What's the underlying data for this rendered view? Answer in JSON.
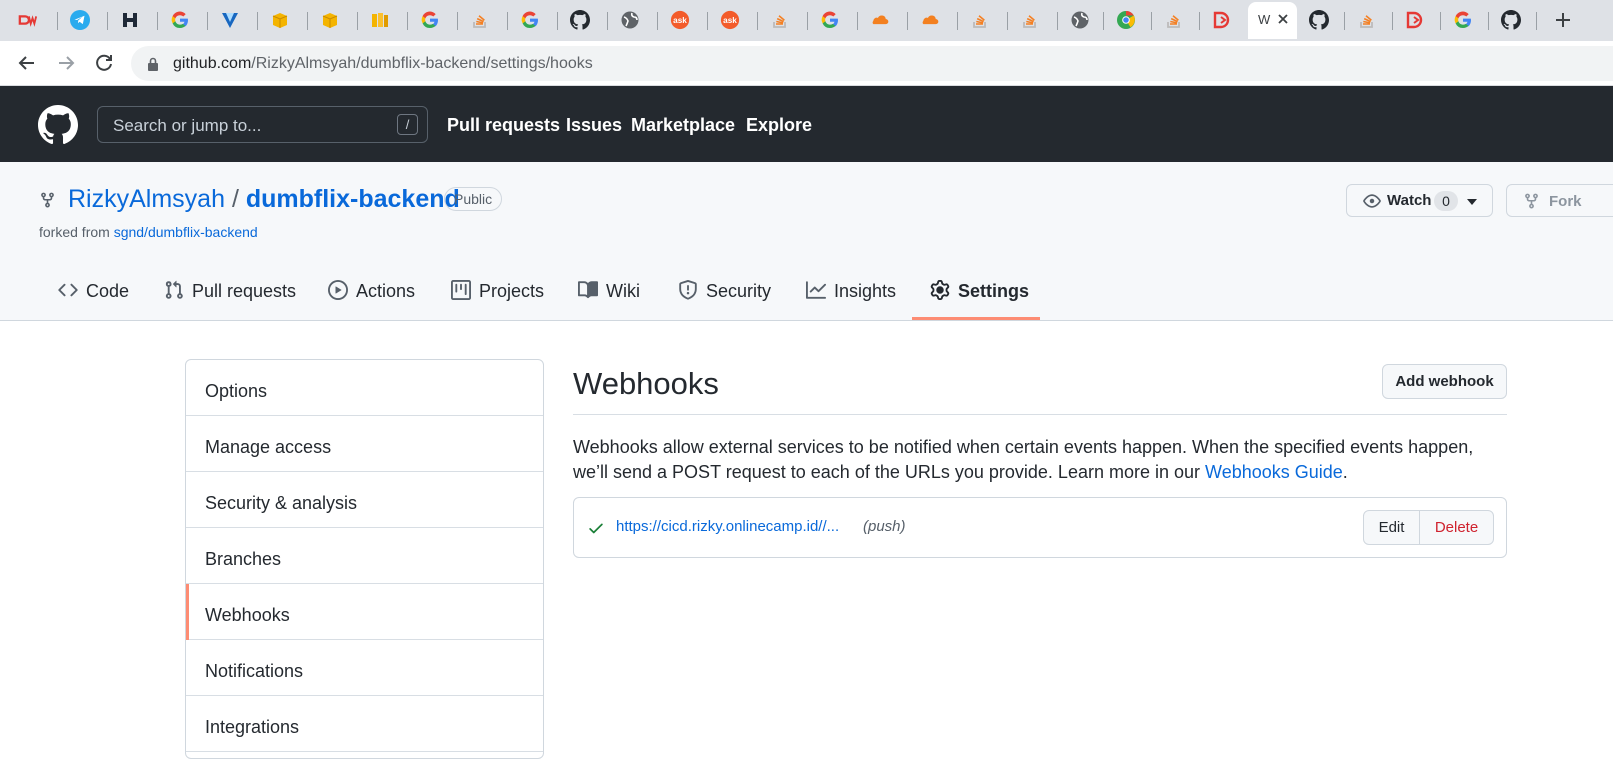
{
  "browser": {
    "tabs": [
      {
        "icon": "dumbways-icon",
        "color": "#e53935"
      },
      {
        "icon": "telegram-icon",
        "color": "#2aabee"
      },
      {
        "icon": "hackerrank-icon",
        "color": "#1f2937"
      },
      {
        "icon": "google-icon",
        "color": "#4285f4"
      },
      {
        "icon": "vuetify-icon",
        "color": "#1867c0"
      },
      {
        "icon": "box-icon",
        "color": "#f4b400"
      },
      {
        "icon": "box-icon",
        "color": "#f4b400"
      },
      {
        "icon": "books-icon",
        "color": "#f4b400"
      },
      {
        "icon": "google-icon",
        "color": "#4285f4"
      },
      {
        "icon": "stackoverflow-icon",
        "color": "#f48024"
      },
      {
        "icon": "google-icon",
        "color": "#4285f4"
      },
      {
        "icon": "github-icon",
        "color": "#24292f"
      },
      {
        "icon": "globe-icon",
        "color": "#5f6368"
      },
      {
        "icon": "askfm-icon",
        "color": "#f35b2a"
      },
      {
        "icon": "askfm-icon",
        "color": "#f35b2a"
      },
      {
        "icon": "stackoverflow-icon",
        "color": "#f48024"
      },
      {
        "icon": "google-icon",
        "color": "#4285f4"
      },
      {
        "icon": "cloudflare-icon",
        "color": "#f38020"
      },
      {
        "icon": "cloudflare-icon",
        "color": "#f38020"
      },
      {
        "icon": "stackoverflow-icon",
        "color": "#f48024"
      },
      {
        "icon": "stackoverflow-icon",
        "color": "#f48024"
      },
      {
        "icon": "globe-icon",
        "color": "#5f6368"
      },
      {
        "icon": "chrome-icon",
        "color": "#34a853"
      },
      {
        "icon": "stackoverflow-icon",
        "color": "#f48024"
      },
      {
        "icon": "dicoding-icon",
        "color": "#e53935"
      },
      {
        "icon": "webhooks-tab",
        "color": "#3c4043",
        "active": true,
        "title": "W"
      },
      {
        "icon": "github-icon",
        "color": "#24292f"
      },
      {
        "icon": "stackoverflow-icon",
        "color": "#f48024"
      },
      {
        "icon": "dicoding-icon",
        "color": "#e53935"
      },
      {
        "icon": "google-icon",
        "color": "#4285f4"
      },
      {
        "icon": "github-icon",
        "color": "#24292f"
      }
    ],
    "url_host": "github.com",
    "url_path": "/RizkyAlmsyah/dumbflix-backend/settings/hooks"
  },
  "header": {
    "search_placeholder": "Search or jump to...",
    "search_shortcut": "/",
    "nav": [
      "Pull requests",
      "Issues",
      "Marketplace",
      "Explore"
    ]
  },
  "repo": {
    "owner": "RizkyAlmsyah",
    "separator": "/",
    "name": "dumbflix-backend",
    "visibility": "Public",
    "forked_prefix": "forked from",
    "forked_source": "sgnd/dumbflix-backend",
    "watch_label": "Watch",
    "watch_count": "0",
    "fork_label": "Fork",
    "tabs": [
      {
        "label": "Code",
        "icon": "code-icon"
      },
      {
        "label": "Pull requests",
        "icon": "pull-request-icon"
      },
      {
        "label": "Actions",
        "icon": "play-icon"
      },
      {
        "label": "Projects",
        "icon": "project-icon"
      },
      {
        "label": "Wiki",
        "icon": "book-icon"
      },
      {
        "label": "Security",
        "icon": "shield-icon"
      },
      {
        "label": "Insights",
        "icon": "graph-icon"
      },
      {
        "label": "Settings",
        "icon": "gear-icon",
        "selected": true
      }
    ]
  },
  "sidebar": {
    "items": [
      "Options",
      "Manage access",
      "Security & analysis",
      "Branches",
      "Webhooks",
      "Notifications",
      "Integrations"
    ],
    "selected": "Webhooks"
  },
  "main": {
    "title": "Webhooks",
    "add_button": "Add webhook",
    "description": "Webhooks allow external services to be notified when certain events happen. When the specified events happen, we’ll send a POST request to each of the URLs you provide. Learn more in our",
    "guide_link": "Webhooks Guide",
    "guide_suffix": ".",
    "hook": {
      "url": "https://cicd.rizky.onlinecamp.id//...",
      "event": "(push)",
      "edit_label": "Edit",
      "delete_label": "Delete"
    }
  },
  "colors": {
    "accent_underline": "#fd8c73",
    "link": "#0969da",
    "danger": "#cf222e",
    "success": "#1a7f37",
    "header_bg": "#24292f"
  }
}
